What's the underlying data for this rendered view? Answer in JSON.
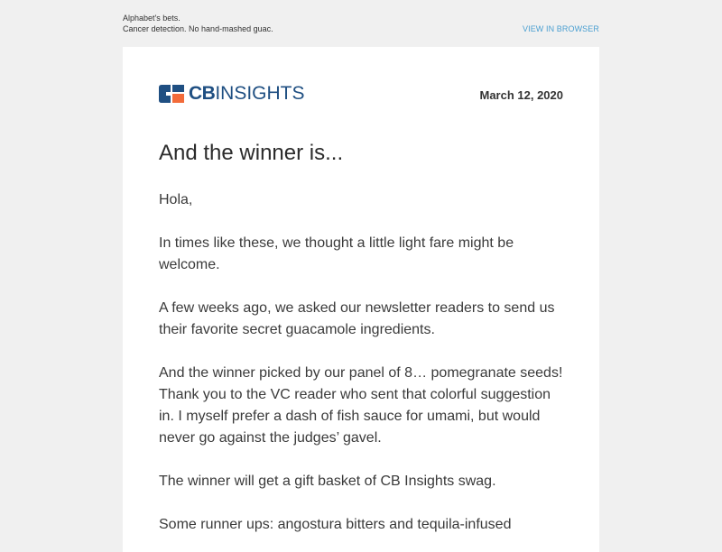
{
  "preheader": {
    "line1": "Alphabet's bets.",
    "line2": "Cancer detection. No hand-mashed guac."
  },
  "view_in_browser": "VIEW IN BROWSER",
  "logo": {
    "text_bold": "CB",
    "text_regular": "INSIGHTS",
    "icon": "cb-insights-logo-icon",
    "colors": {
      "blue": "#1f4f82",
      "orange": "#f26b3a"
    }
  },
  "date": "March 12, 2020",
  "headline": "And the winner is...",
  "paragraphs": [
    "Hola,",
    "In times like these, we thought a little light fare might be welcome.",
    "A few weeks ago, we asked our newsletter readers to send us their favorite secret guacamole ingredients.",
    "And the winner picked by our panel of 8… pomegranate seeds! Thank you to the VC reader who sent that colorful suggestion in. I myself prefer a dash of fish sauce for umami, but would never go against the judges’ gavel.",
    "The winner will get a gift basket of CB Insights swag.",
    "Some runner ups: angostura bitters and tequila-infused"
  ]
}
